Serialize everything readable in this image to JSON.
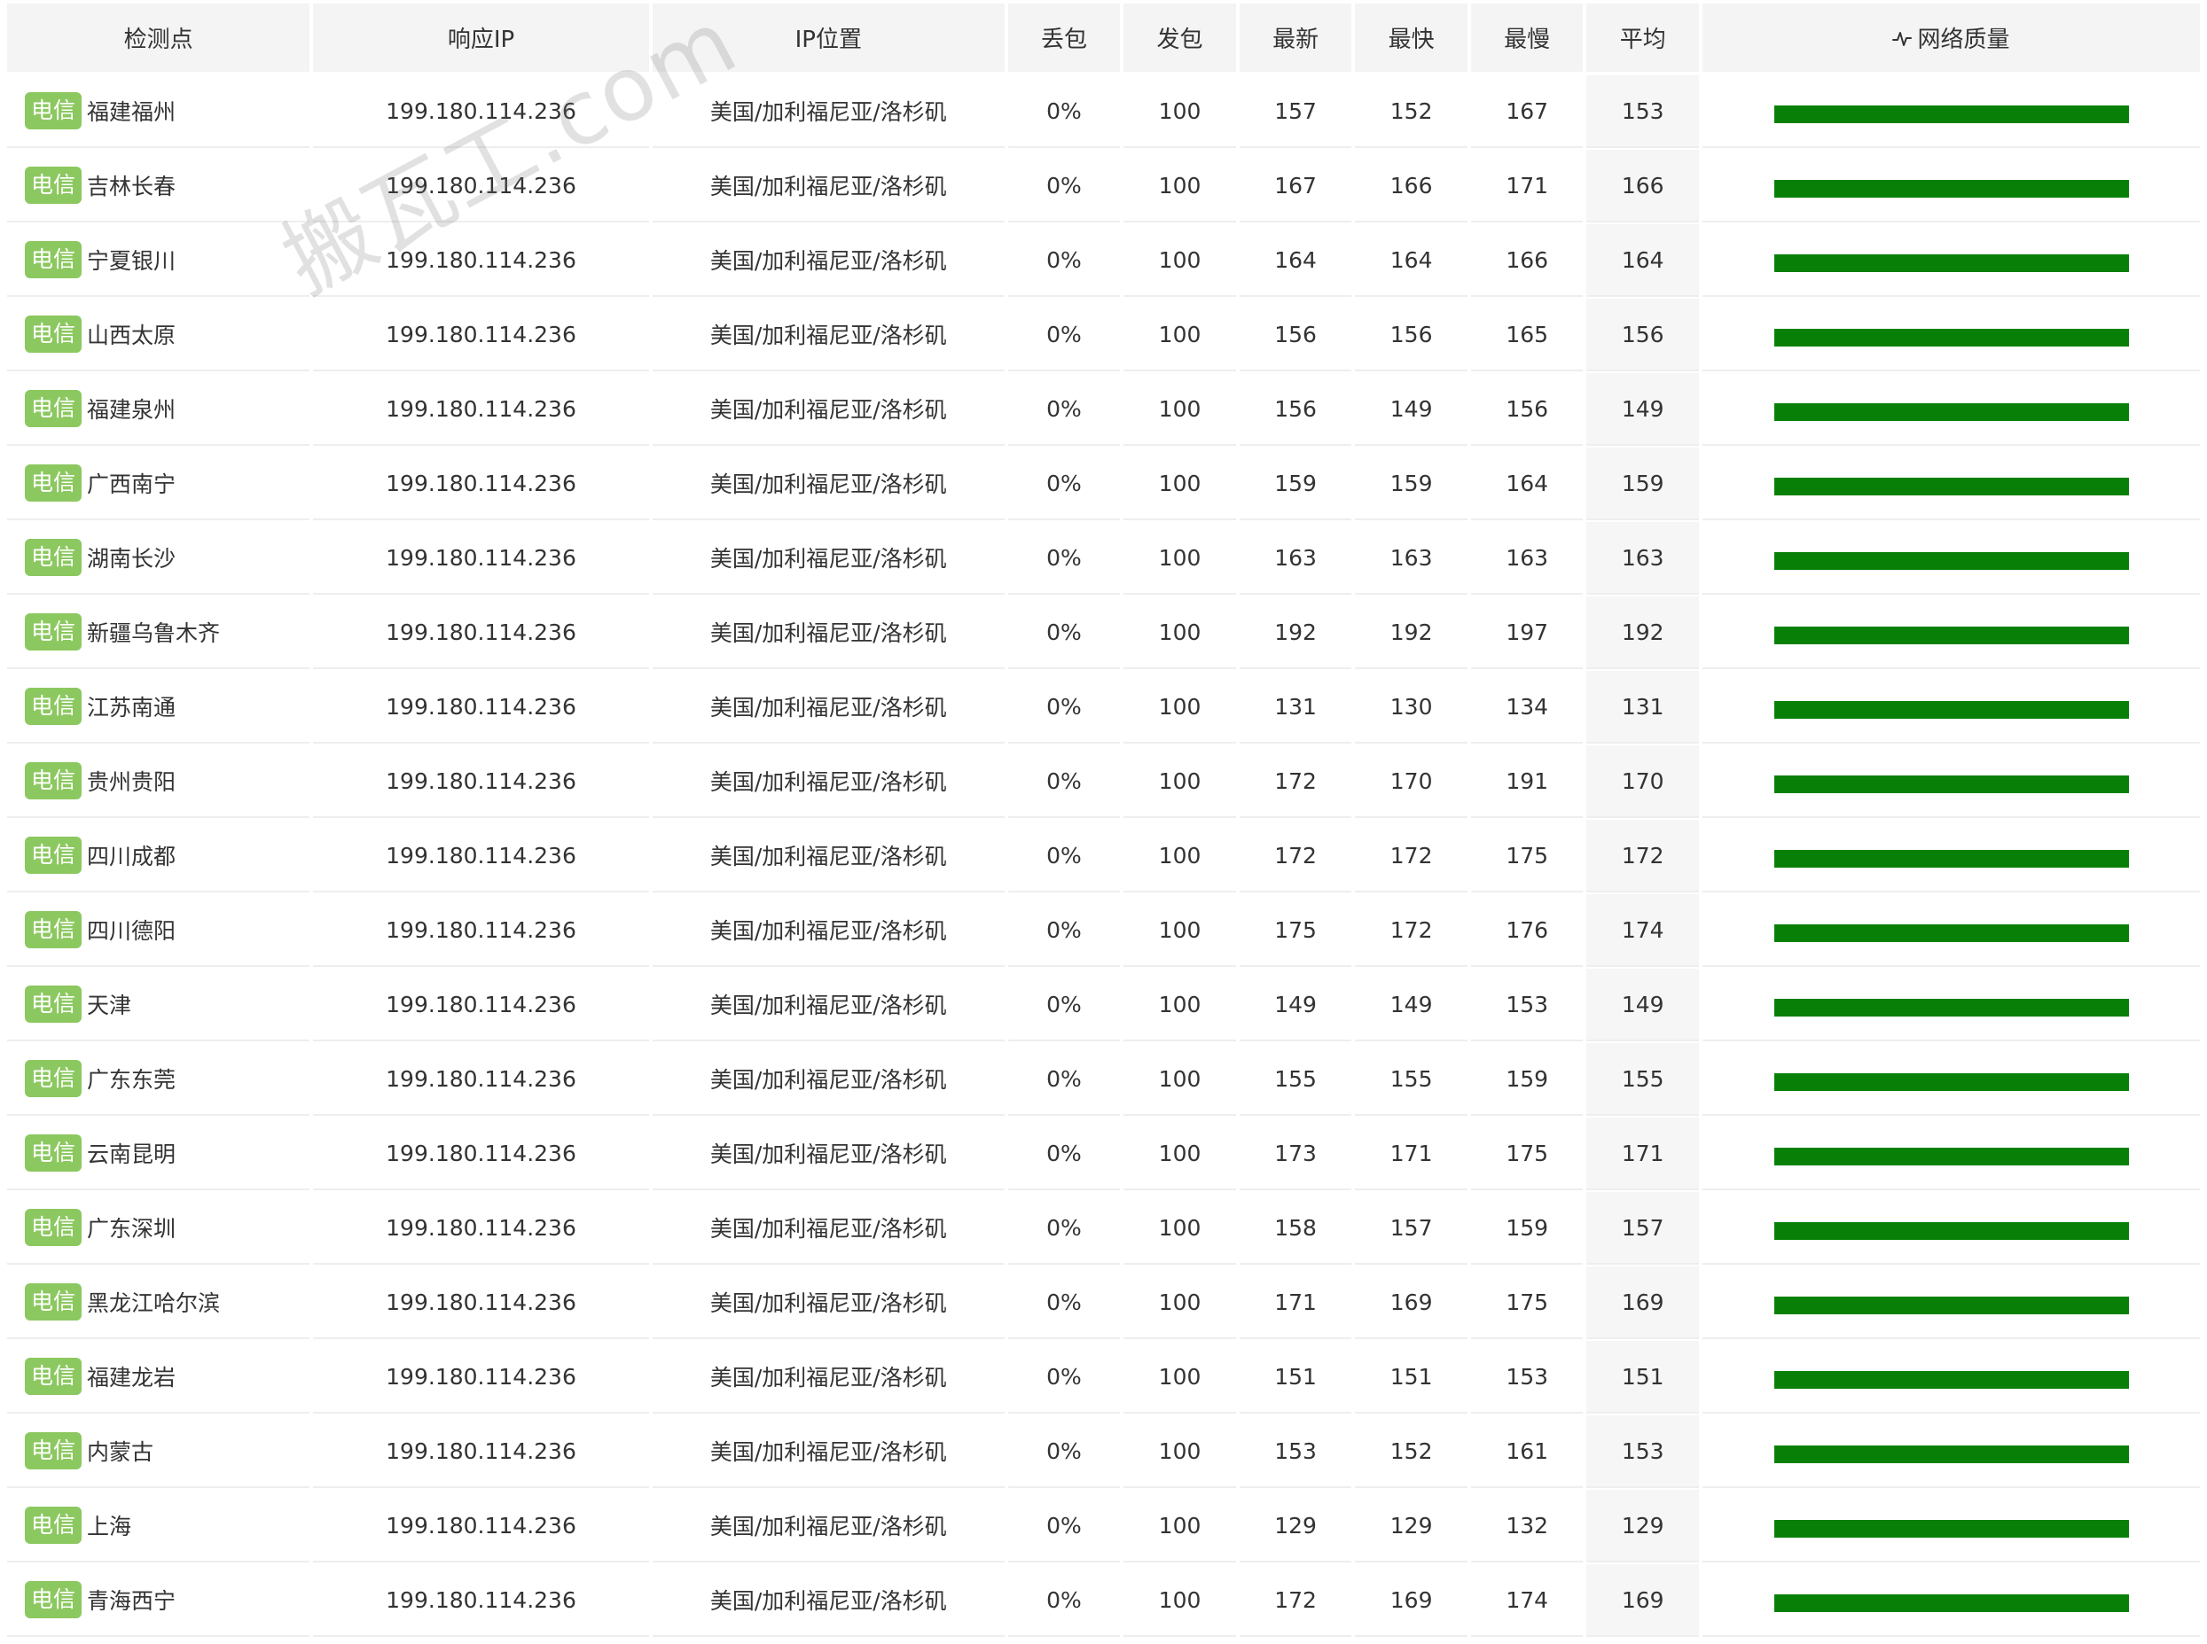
{
  "colors": {
    "badge_bg": "#8cc860",
    "quality_bar": "#088008",
    "header_bg": "#f4f4f4"
  },
  "columns": {
    "node": "检测点",
    "ip": "响应IP",
    "location": "IP位置",
    "loss": "丢包",
    "sent": "发包",
    "latest": "最新",
    "fastest": "最快",
    "slowest": "最慢",
    "average": "平均",
    "quality": "网络质量"
  },
  "quality_icon": "activity-icon",
  "watermark": "搬瓦工.com",
  "rows": [
    {
      "isp": "电信",
      "node": "福建福州",
      "ip": "199.180.114.236",
      "location": "美国/加利福尼亚/洛杉矶",
      "loss": "0%",
      "sent": "100",
      "latest": "157",
      "fastest": "152",
      "slowest": "167",
      "average": "153"
    },
    {
      "isp": "电信",
      "node": "吉林长春",
      "ip": "199.180.114.236",
      "location": "美国/加利福尼亚/洛杉矶",
      "loss": "0%",
      "sent": "100",
      "latest": "167",
      "fastest": "166",
      "slowest": "171",
      "average": "166"
    },
    {
      "isp": "电信",
      "node": "宁夏银川",
      "ip": "199.180.114.236",
      "location": "美国/加利福尼亚/洛杉矶",
      "loss": "0%",
      "sent": "100",
      "latest": "164",
      "fastest": "164",
      "slowest": "166",
      "average": "164"
    },
    {
      "isp": "电信",
      "node": "山西太原",
      "ip": "199.180.114.236",
      "location": "美国/加利福尼亚/洛杉矶",
      "loss": "0%",
      "sent": "100",
      "latest": "156",
      "fastest": "156",
      "slowest": "165",
      "average": "156"
    },
    {
      "isp": "电信",
      "node": "福建泉州",
      "ip": "199.180.114.236",
      "location": "美国/加利福尼亚/洛杉矶",
      "loss": "0%",
      "sent": "100",
      "latest": "156",
      "fastest": "149",
      "slowest": "156",
      "average": "149"
    },
    {
      "isp": "电信",
      "node": "广西南宁",
      "ip": "199.180.114.236",
      "location": "美国/加利福尼亚/洛杉矶",
      "loss": "0%",
      "sent": "100",
      "latest": "159",
      "fastest": "159",
      "slowest": "164",
      "average": "159"
    },
    {
      "isp": "电信",
      "node": "湖南长沙",
      "ip": "199.180.114.236",
      "location": "美国/加利福尼亚/洛杉矶",
      "loss": "0%",
      "sent": "100",
      "latest": "163",
      "fastest": "163",
      "slowest": "163",
      "average": "163"
    },
    {
      "isp": "电信",
      "node": "新疆乌鲁木齐",
      "ip": "199.180.114.236",
      "location": "美国/加利福尼亚/洛杉矶",
      "loss": "0%",
      "sent": "100",
      "latest": "192",
      "fastest": "192",
      "slowest": "197",
      "average": "192"
    },
    {
      "isp": "电信",
      "node": "江苏南通",
      "ip": "199.180.114.236",
      "location": "美国/加利福尼亚/洛杉矶",
      "loss": "0%",
      "sent": "100",
      "latest": "131",
      "fastest": "130",
      "slowest": "134",
      "average": "131"
    },
    {
      "isp": "电信",
      "node": "贵州贵阳",
      "ip": "199.180.114.236",
      "location": "美国/加利福尼亚/洛杉矶",
      "loss": "0%",
      "sent": "100",
      "latest": "172",
      "fastest": "170",
      "slowest": "191",
      "average": "170"
    },
    {
      "isp": "电信",
      "node": "四川成都",
      "ip": "199.180.114.236",
      "location": "美国/加利福尼亚/洛杉矶",
      "loss": "0%",
      "sent": "100",
      "latest": "172",
      "fastest": "172",
      "slowest": "175",
      "average": "172"
    },
    {
      "isp": "电信",
      "node": "四川德阳",
      "ip": "199.180.114.236",
      "location": "美国/加利福尼亚/洛杉矶",
      "loss": "0%",
      "sent": "100",
      "latest": "175",
      "fastest": "172",
      "slowest": "176",
      "average": "174"
    },
    {
      "isp": "电信",
      "node": "天津",
      "ip": "199.180.114.236",
      "location": "美国/加利福尼亚/洛杉矶",
      "loss": "0%",
      "sent": "100",
      "latest": "149",
      "fastest": "149",
      "slowest": "153",
      "average": "149"
    },
    {
      "isp": "电信",
      "node": "广东东莞",
      "ip": "199.180.114.236",
      "location": "美国/加利福尼亚/洛杉矶",
      "loss": "0%",
      "sent": "100",
      "latest": "155",
      "fastest": "155",
      "slowest": "159",
      "average": "155"
    },
    {
      "isp": "电信",
      "node": "云南昆明",
      "ip": "199.180.114.236",
      "location": "美国/加利福尼亚/洛杉矶",
      "loss": "0%",
      "sent": "100",
      "latest": "173",
      "fastest": "171",
      "slowest": "175",
      "average": "171"
    },
    {
      "isp": "电信",
      "node": "广东深圳",
      "ip": "199.180.114.236",
      "location": "美国/加利福尼亚/洛杉矶",
      "loss": "0%",
      "sent": "100",
      "latest": "158",
      "fastest": "157",
      "slowest": "159",
      "average": "157"
    },
    {
      "isp": "电信",
      "node": "黑龙江哈尔滨",
      "ip": "199.180.114.236",
      "location": "美国/加利福尼亚/洛杉矶",
      "loss": "0%",
      "sent": "100",
      "latest": "171",
      "fastest": "169",
      "slowest": "175",
      "average": "169"
    },
    {
      "isp": "电信",
      "node": "福建龙岩",
      "ip": "199.180.114.236",
      "location": "美国/加利福尼亚/洛杉矶",
      "loss": "0%",
      "sent": "100",
      "latest": "151",
      "fastest": "151",
      "slowest": "153",
      "average": "151"
    },
    {
      "isp": "电信",
      "node": "内蒙古",
      "ip": "199.180.114.236",
      "location": "美国/加利福尼亚/洛杉矶",
      "loss": "0%",
      "sent": "100",
      "latest": "153",
      "fastest": "152",
      "slowest": "161",
      "average": "153"
    },
    {
      "isp": "电信",
      "node": "上海",
      "ip": "199.180.114.236",
      "location": "美国/加利福尼亚/洛杉矶",
      "loss": "0%",
      "sent": "100",
      "latest": "129",
      "fastest": "129",
      "slowest": "132",
      "average": "129"
    },
    {
      "isp": "电信",
      "node": "青海西宁",
      "ip": "199.180.114.236",
      "location": "美国/加利福尼亚/洛杉矶",
      "loss": "0%",
      "sent": "100",
      "latest": "172",
      "fastest": "169",
      "slowest": "174",
      "average": "169"
    }
  ]
}
